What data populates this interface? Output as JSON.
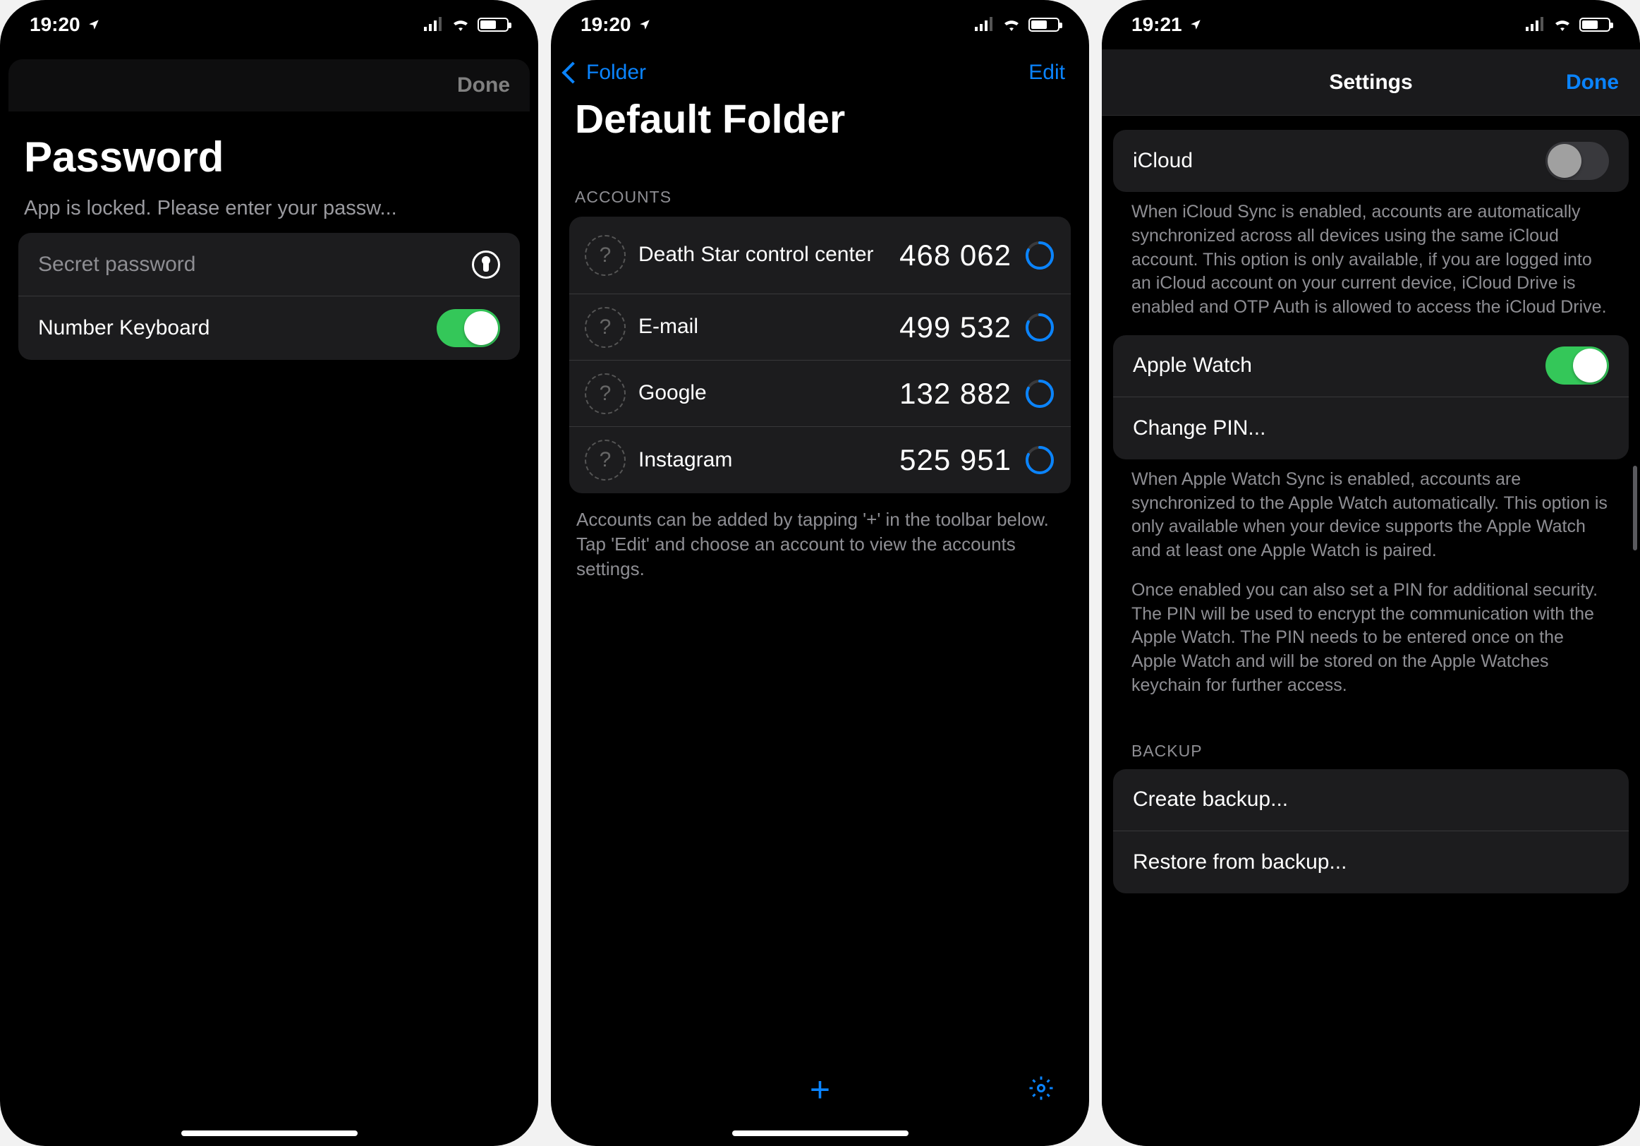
{
  "screen1": {
    "status_time": "19:20",
    "done_label": "Done",
    "title": "Password",
    "subtitle": "App is locked. Please enter your passw...",
    "password_placeholder": "Secret password",
    "number_keyboard_label": "Number Keyboard"
  },
  "screen2": {
    "status_time": "19:20",
    "back_label": "Folder",
    "edit_label": "Edit",
    "title": "Default Folder",
    "section_label": "ACCOUNTS",
    "accounts": [
      {
        "name": "Death Star control center",
        "code": "468 062"
      },
      {
        "name": "E-mail",
        "code": "499 532"
      },
      {
        "name": "Google",
        "code": "132 882"
      },
      {
        "name": "Instagram",
        "code": "525 951"
      }
    ],
    "hint": "Accounts can be added by tapping '+' in the toolbar below. Tap 'Edit' and choose an account to view the accounts settings."
  },
  "screen3": {
    "status_time": "19:21",
    "title": "Settings",
    "done_label": "Done",
    "icloud_label": "iCloud",
    "icloud_desc": "When iCloud Sync is enabled, accounts are automatically synchronized across all devices using the same iCloud account. This option is only available, if you are logged into an iCloud account on your current device, iCloud Drive is enabled and OTP Auth is allowed to access the iCloud Drive.",
    "apple_watch_label": "Apple Watch",
    "change_pin_label": "Change PIN...",
    "watch_desc1": "When Apple Watch Sync is enabled, accounts are synchronized to the Apple Watch automatically. This option is only available when your device supports the Apple Watch and at least one Apple Watch is paired.",
    "watch_desc2": "Once enabled you can also set a PIN for additional security. The PIN will be used to encrypt the communication with the Apple Watch. The PIN needs to be entered once on the Apple Watch and will be stored on the Apple Watches keychain for further access.",
    "backup_header": "BACKUP",
    "create_backup_label": "Create backup...",
    "restore_backup_label": "Restore from backup..."
  }
}
